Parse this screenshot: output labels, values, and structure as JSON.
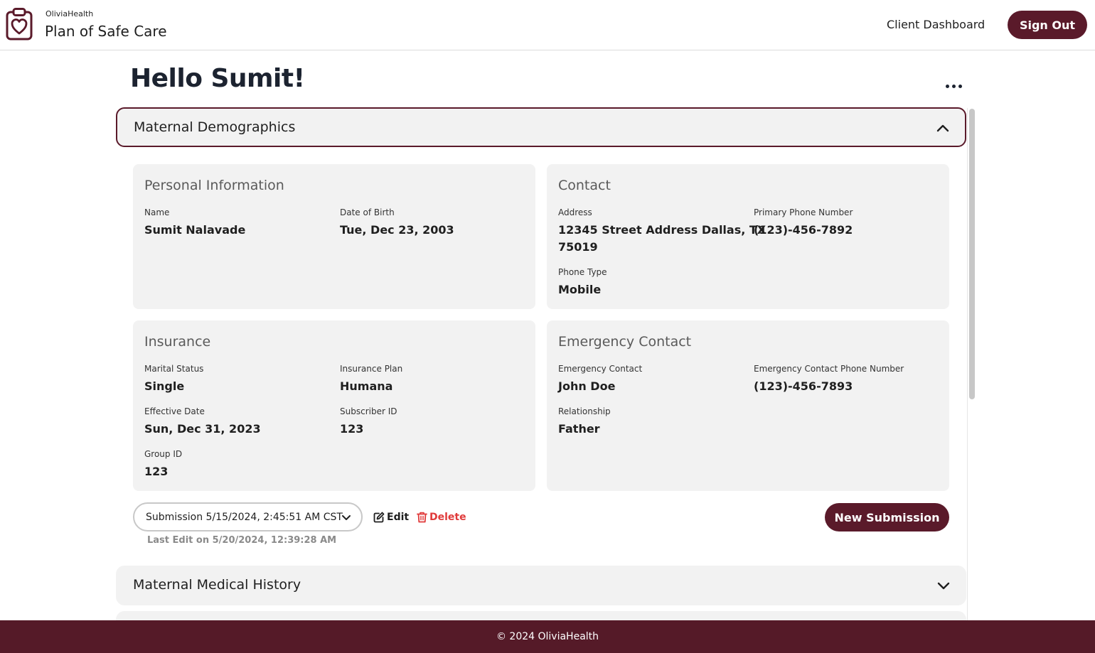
{
  "header": {
    "brand_small": "OliviaHealth",
    "brand_title": "Plan of Safe Care",
    "nav_link": "Client Dashboard",
    "signout_label": "Sign Out"
  },
  "greeting": "Hello Sumit!",
  "sections": {
    "maternal_demographics": "Maternal Demographics",
    "maternal_medical_history": "Maternal Medical History"
  },
  "personal": {
    "title": "Personal Information",
    "name_label": "Name",
    "name_value": "Sumit Nalavade",
    "dob_label": "Date of Birth",
    "dob_value": "Tue, Dec 23, 2003"
  },
  "contact": {
    "title": "Contact",
    "address_label": "Address",
    "address_line1": "12345 Street Address Dallas, TX",
    "address_line2": "75019",
    "phone_label": "Primary Phone Number",
    "phone_value": "(123)-456-7892",
    "phone_type_label": "Phone Type",
    "phone_type_value": "Mobile"
  },
  "insurance": {
    "title": "Insurance",
    "marital_label": "Marital Status",
    "marital_value": "Single",
    "plan_label": "Insurance Plan",
    "plan_value": "Humana",
    "effective_label": "Effective Date",
    "effective_value": "Sun, Dec 31, 2023",
    "subscriber_label": "Subscriber ID",
    "subscriber_value": "123",
    "group_label": "Group ID",
    "group_value": "123"
  },
  "emergency": {
    "title": "Emergency Contact",
    "contact_label": "Emergency Contact",
    "contact_value": "John Doe",
    "phone_label": "Emergency Contact Phone Number",
    "phone_value": "(123)-456-7893",
    "relationship_label": "Relationship",
    "relationship_value": "Father"
  },
  "submission": {
    "selected": "Submission 5/15/2024, 2:45:51 AM CST",
    "edit_label": "Edit",
    "delete_label": "Delete",
    "last_edit": "Last Edit on 5/20/2024, 12:39:28 AM",
    "new_label": "New Submission"
  },
  "footer": {
    "text": "© 2024 OliviaHealth"
  },
  "colors": {
    "brand": "#5a1a2a",
    "footer": "#551a28",
    "delete": "#e03a3a",
    "card_bg": "#f2f2f2"
  },
  "icons": [
    "clipboard-heart-icon",
    "more-horizontal-icon",
    "chevron-up-icon",
    "chevron-down-icon",
    "edit-icon",
    "trash-icon"
  ]
}
